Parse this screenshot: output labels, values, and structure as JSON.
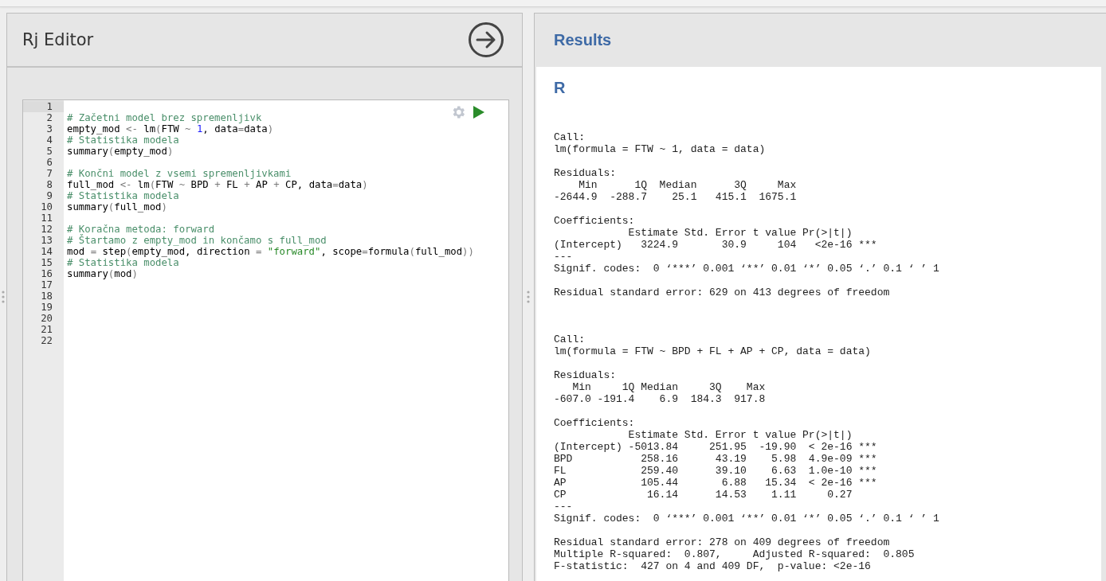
{
  "editor_panel": {
    "title": "Rj Editor",
    "lines": [
      {
        "number": "1",
        "active": true
      },
      {
        "number": "2",
        "active": false,
        "tokens": [
          {
            "kind": "comment",
            "text": "# Začetni model brez spremenljivk"
          }
        ]
      },
      {
        "number": "3",
        "active": false,
        "tokens": [
          {
            "kind": "plain",
            "text": "empty_mod "
          },
          {
            "kind": "op",
            "text": "<-"
          },
          {
            "kind": "plain",
            "text": " lm"
          },
          {
            "kind": "op",
            "text": "("
          },
          {
            "kind": "plain",
            "text": "FTW "
          },
          {
            "kind": "op",
            "text": "~ "
          },
          {
            "kind": "number",
            "text": "1"
          },
          {
            "kind": "plain",
            "text": ", data"
          },
          {
            "kind": "op",
            "text": "="
          },
          {
            "kind": "plain",
            "text": "data"
          },
          {
            "kind": "op",
            "text": ")"
          }
        ]
      },
      {
        "number": "4",
        "active": false,
        "tokens": [
          {
            "kind": "comment",
            "text": "# Statistika modela"
          }
        ]
      },
      {
        "number": "5",
        "active": false,
        "tokens": [
          {
            "kind": "plain",
            "text": "summary"
          },
          {
            "kind": "op",
            "text": "("
          },
          {
            "kind": "plain",
            "text": "empty_mod"
          },
          {
            "kind": "op",
            "text": ")"
          }
        ]
      },
      {
        "number": "6",
        "active": false
      },
      {
        "number": "7",
        "active": false,
        "tokens": [
          {
            "kind": "comment",
            "text": "# Končni model z vsemi spremenljivkami"
          }
        ]
      },
      {
        "number": "8",
        "active": false,
        "tokens": [
          {
            "kind": "plain",
            "text": "full_mod "
          },
          {
            "kind": "op",
            "text": "<-"
          },
          {
            "kind": "plain",
            "text": " lm"
          },
          {
            "kind": "op",
            "text": "("
          },
          {
            "kind": "plain",
            "text": "FTW "
          },
          {
            "kind": "op",
            "text": "~"
          },
          {
            "kind": "plain",
            "text": " BPD "
          },
          {
            "kind": "op",
            "text": "+"
          },
          {
            "kind": "plain",
            "text": " FL "
          },
          {
            "kind": "op",
            "text": "+"
          },
          {
            "kind": "plain",
            "text": " AP "
          },
          {
            "kind": "op",
            "text": "+"
          },
          {
            "kind": "plain",
            "text": " CP, data"
          },
          {
            "kind": "op",
            "text": "="
          },
          {
            "kind": "plain",
            "text": "data"
          },
          {
            "kind": "op",
            "text": ")"
          }
        ]
      },
      {
        "number": "9",
        "active": false,
        "tokens": [
          {
            "kind": "comment",
            "text": "# Statistika modela"
          }
        ]
      },
      {
        "number": "10",
        "active": false,
        "tokens": [
          {
            "kind": "plain",
            "text": "summary"
          },
          {
            "kind": "op",
            "text": "("
          },
          {
            "kind": "plain",
            "text": "full_mod"
          },
          {
            "kind": "op",
            "text": ")"
          }
        ]
      },
      {
        "number": "11",
        "active": false
      },
      {
        "number": "12",
        "active": false,
        "tokens": [
          {
            "kind": "comment",
            "text": "# Koračna metoda: forward"
          }
        ]
      },
      {
        "number": "13",
        "active": false,
        "tokens": [
          {
            "kind": "comment",
            "text": "# Štartamo z empty_mod in končamo s full_mod"
          }
        ]
      },
      {
        "number": "14",
        "active": false,
        "tokens": [
          {
            "kind": "plain",
            "text": "mod "
          },
          {
            "kind": "op",
            "text": "="
          },
          {
            "kind": "plain",
            "text": " step"
          },
          {
            "kind": "op",
            "text": "("
          },
          {
            "kind": "plain",
            "text": "empty_mod, direction "
          },
          {
            "kind": "op",
            "text": "= "
          },
          {
            "kind": "string",
            "text": "\"forward\""
          },
          {
            "kind": "plain",
            "text": ", scope"
          },
          {
            "kind": "op",
            "text": "="
          },
          {
            "kind": "plain",
            "text": "formula"
          },
          {
            "kind": "op",
            "text": "("
          },
          {
            "kind": "plain",
            "text": "full_mod"
          },
          {
            "kind": "op",
            "text": "))"
          }
        ]
      },
      {
        "number": "15",
        "active": false,
        "tokens": [
          {
            "kind": "comment",
            "text": "# Statistika modela"
          }
        ]
      },
      {
        "number": "16",
        "active": false,
        "tokens": [
          {
            "kind": "plain",
            "text": "summary"
          },
          {
            "kind": "op",
            "text": "("
          },
          {
            "kind": "plain",
            "text": "mod"
          },
          {
            "kind": "op",
            "text": ")"
          }
        ]
      },
      {
        "number": "17",
        "active": false
      },
      {
        "number": "18",
        "active": false
      },
      {
        "number": "19",
        "active": false
      },
      {
        "number": "20",
        "active": false
      },
      {
        "number": "21",
        "active": false
      },
      {
        "number": "22",
        "active": false
      }
    ]
  },
  "results_panel": {
    "title": "Results",
    "section_title": "R",
    "outputs": [
      {
        "sections": [
          [
            "Call:",
            "lm(formula = FTW ~ 1, data = data)"
          ],
          [
            "Residuals:",
            "    Min      1Q  Median      3Q     Max ",
            "-2644.9  -288.7    25.1   415.1  1675.1 "
          ],
          [
            "Coefficients:",
            "            Estimate Std. Error t value Pr(>|t|)    ",
            "(Intercept)   3224.9       30.9     104   <2e-16 ***",
            "---",
            "Signif. codes:  0 ‘***’ 0.001 ‘**’ 0.01 ‘*’ 0.05 ‘.’ 0.1 ‘ ’ 1"
          ],
          [
            "Residual standard error: 629 on 413 degrees of freedom"
          ]
        ]
      },
      {
        "sections": [
          [
            "Call:",
            "lm(formula = FTW ~ BPD + FL + AP + CP, data = data)"
          ],
          [
            "Residuals:",
            "   Min     1Q Median     3Q    Max ",
            "-607.0 -191.4    6.9  184.3  917.8 "
          ],
          [
            "Coefficients:",
            "            Estimate Std. Error t value Pr(>|t|)    ",
            "(Intercept) -5013.84     251.95  -19.90  < 2e-16 ***",
            "BPD           258.16      43.19    5.98  4.9e-09 ***",
            "FL            259.40      39.10    6.63  1.0e-10 ***",
            "AP            105.44       6.88   15.34  < 2e-16 ***",
            "CP             16.14      14.53    1.11     0.27    ",
            "---",
            "Signif. codes:  0 ‘***’ 0.001 ‘**’ 0.01 ‘*’ 0.05 ‘.’ 0.1 ‘ ’ 1"
          ],
          [
            "Residual standard error: 278 on 409 degrees of freedom",
            "Multiple R-squared:  0.807,\tAdjusted R-squared:  0.805 ",
            "F-statistic:  427 on 4 and 409 DF,  p-value: <2e-16"
          ]
        ]
      }
    ]
  }
}
